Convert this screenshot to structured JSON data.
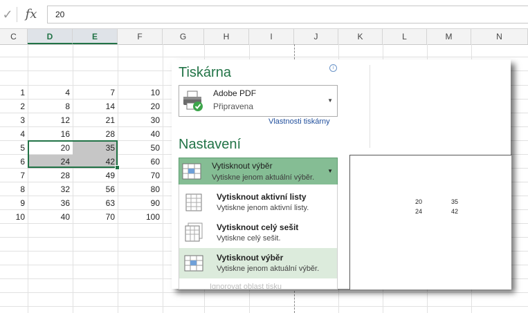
{
  "formula_bar": {
    "check_icon": "✓",
    "fx_label": "fx",
    "value": "20"
  },
  "columns": [
    "C",
    "D",
    "E",
    "F",
    "G",
    "H",
    "I",
    "J",
    "K",
    "L",
    "M",
    "N"
  ],
  "selected_columns": [
    "D",
    "E"
  ],
  "rows": [
    [
      "1",
      "4",
      "7",
      "10"
    ],
    [
      "2",
      "8",
      "14",
      "20"
    ],
    [
      "3",
      "12",
      "21",
      "30"
    ],
    [
      "4",
      "16",
      "28",
      "40"
    ],
    [
      "5",
      "20",
      "35",
      "50"
    ],
    [
      "6",
      "24",
      "42",
      "60"
    ],
    [
      "7",
      "28",
      "49",
      "70"
    ],
    [
      "8",
      "32",
      "56",
      "80"
    ],
    [
      "9",
      "36",
      "63",
      "90"
    ],
    [
      "10",
      "40",
      "70",
      "100"
    ]
  ],
  "print_panel": {
    "printer_title": "Tiskárna",
    "info_icon": "i",
    "printer_name": "Adobe PDF",
    "printer_status": "Připravena",
    "printer_properties_link": "Vlastnosti tiskárny",
    "settings_title": "Nastavení",
    "selected_setting": {
      "title": "Vytisknout výběr",
      "description": "Vytiskne jenom aktuální výběr."
    },
    "options": [
      {
        "title": "Vytisknout aktivní listy",
        "description": "Vytiskne jenom aktivní listy."
      },
      {
        "title": "Vytisknout celý sešit",
        "description": "Vytiskne celý sešit."
      },
      {
        "title": "Vytisknout výběr",
        "description": "Vytiskne jenom aktuální výběr."
      }
    ],
    "ignore_print_area": "Ignorovat oblast tisku",
    "dropdown_arrow": "▼"
  },
  "preview": {
    "values": [
      [
        "20",
        "35"
      ],
      [
        "24",
        "42"
      ]
    ]
  },
  "colors": {
    "accent_green": "#217346",
    "selected_setting_bg": "#85bd94",
    "active_option_bg": "#dcebdc",
    "link_blue": "#1f4e9c"
  }
}
